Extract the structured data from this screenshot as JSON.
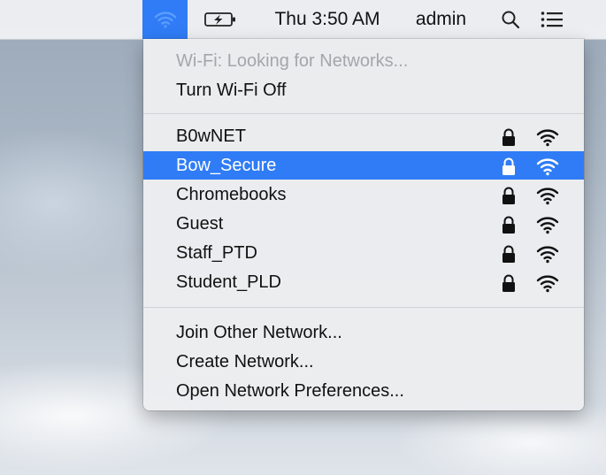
{
  "menubar": {
    "wifi_icon": "wifi-icon",
    "battery_icon": "battery-charging-icon",
    "clock": "Thu 3:50 AM",
    "user": "admin",
    "search_icon": "search-icon",
    "list_icon": "notification-list-icon",
    "accent": "#2f7cf6"
  },
  "wifi_menu": {
    "status": "Wi-Fi: Looking for Networks...",
    "toggle": "Turn Wi-Fi Off",
    "networks": [
      {
        "name": "B0wNET",
        "locked": true
      },
      {
        "name": "Bow_Secure",
        "locked": true,
        "highlighted": true
      },
      {
        "name": "Chromebooks",
        "locked": true
      },
      {
        "name": "Guest",
        "locked": true
      },
      {
        "name": "Staff_PTD",
        "locked": true
      },
      {
        "name": "Student_PLD",
        "locked": true
      }
    ],
    "actions": [
      "Join Other Network...",
      "Create Network...",
      "Open Network Preferences..."
    ]
  }
}
